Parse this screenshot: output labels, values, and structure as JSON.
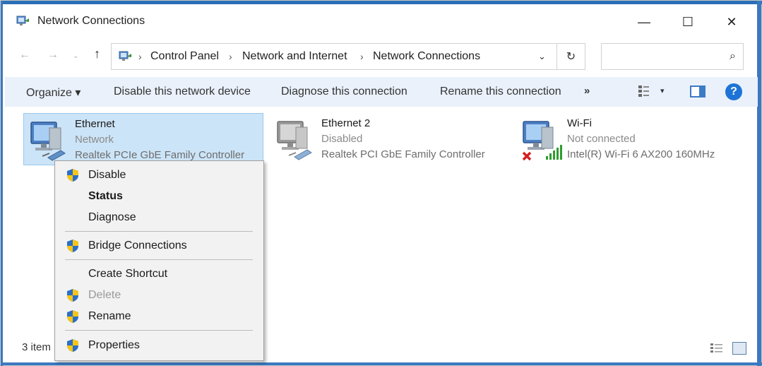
{
  "window": {
    "title": "Network Connections",
    "min_symbol": "—",
    "max_symbol": "☐",
    "close_symbol": "✕"
  },
  "nav": {
    "back_symbol": "←",
    "forward_symbol": "→",
    "recent_symbol": "⌄",
    "up_symbol": "↑",
    "breadcrumb": [
      "Control Panel",
      "Network and Internet",
      "Network Connections"
    ],
    "separator": "›",
    "address_dropdown_symbol": "⌄",
    "refresh_symbol": "↻",
    "search_placeholder": "",
    "search_symbol": "⌕"
  },
  "toolbar": {
    "organize": "Organize ▾",
    "disable": "Disable this network device",
    "diagnose": "Diagnose this connection",
    "rename": "Rename this connection",
    "more": "»",
    "view_dropdown": "▾",
    "help": "?"
  },
  "connections": [
    {
      "name": "Ethernet",
      "status": "Network",
      "device": "Realtek PCIe GbE Family Controller",
      "icon": "ethernet-icon",
      "selected": true
    },
    {
      "name": "Ethernet 2",
      "status": "Disabled",
      "device": "Realtek PCI GbE Family Controller",
      "icon": "ethernet-disabled-icon",
      "selected": false
    },
    {
      "name": "Wi-Fi",
      "status": "Not connected",
      "device": "Intel(R) Wi-Fi 6 AX200 160MHz",
      "icon": "wifi-not-connected-icon",
      "selected": false
    }
  ],
  "status_bar": {
    "item_count": "3 item"
  },
  "context_menu": {
    "items": [
      {
        "label": "Disable",
        "shield": true,
        "bold": false,
        "disabled": false
      },
      {
        "label": "Status",
        "shield": false,
        "bold": true,
        "disabled": false
      },
      {
        "label": "Diagnose",
        "shield": false,
        "bold": false,
        "disabled": false
      },
      {
        "label": "Bridge Connections",
        "shield": true,
        "bold": false,
        "disabled": false
      },
      {
        "label": "Create Shortcut",
        "shield": false,
        "bold": false,
        "disabled": false
      },
      {
        "label": "Delete",
        "shield": true,
        "bold": false,
        "disabled": true
      },
      {
        "label": "Rename",
        "shield": true,
        "bold": false,
        "disabled": false
      },
      {
        "label": "Properties",
        "shield": true,
        "bold": false,
        "disabled": false
      }
    ]
  },
  "colors": {
    "accent": "#2b6fb6",
    "selection": "#cce4f7",
    "command_bar": "#eaf1fb",
    "menu_bg": "#f2f2f2"
  }
}
